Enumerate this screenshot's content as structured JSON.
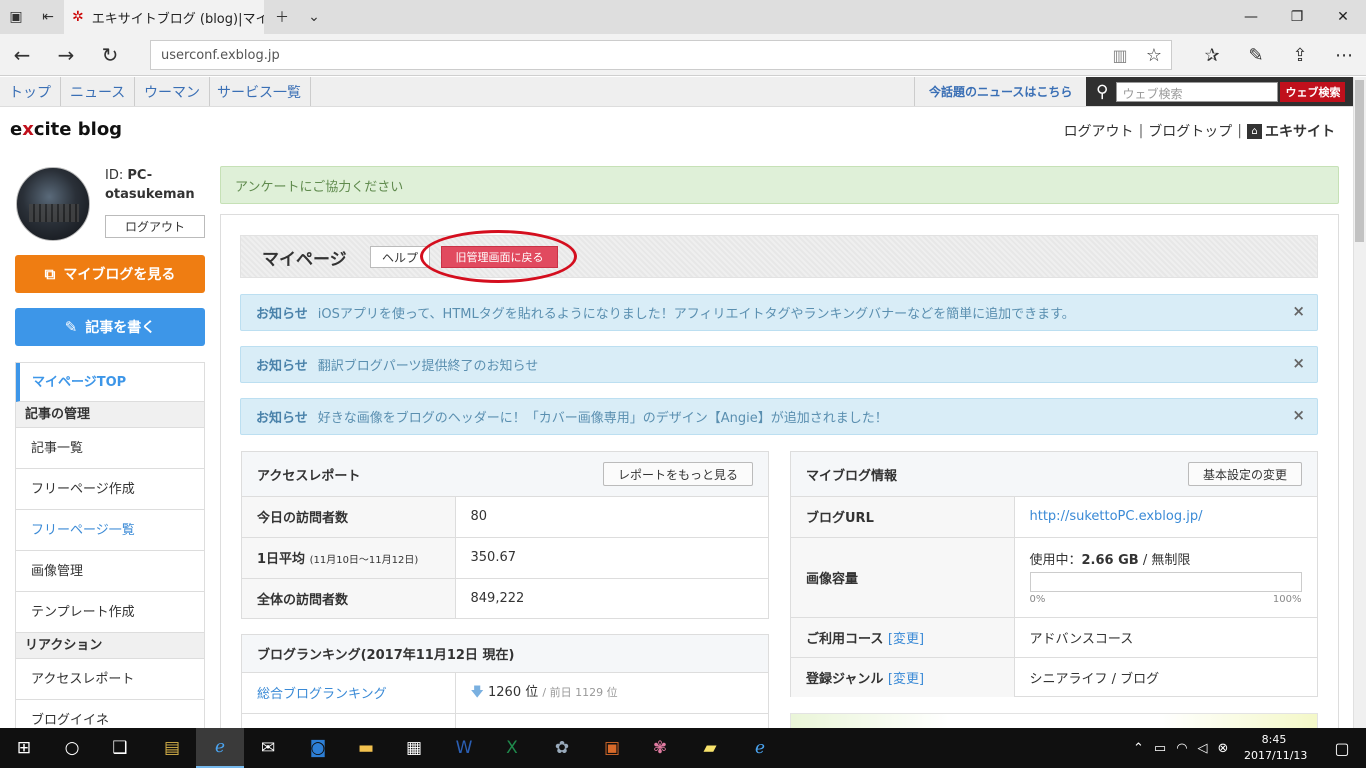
{
  "browser": {
    "tab_title": "エキサイトブログ (blog)|マイ",
    "address": "userconf.exblog.jp"
  },
  "site_nav": {
    "items": [
      "トップ",
      "ニュース",
      "ウーマン",
      "サービス一覧"
    ],
    "trending": "今話題のニュースはこちら",
    "search_placeholder": "ウェブ検索",
    "search_button": "ウェブ検索"
  },
  "header": {
    "logo_e": "e",
    "logo_x": "x",
    "logo_rest": "cite blog",
    "logout": "ログアウト",
    "blog_top": "ブログトップ",
    "excite": "エキサイト",
    "sep": "|"
  },
  "user": {
    "id_label": "ID:",
    "id_value": "PC-otasukeman",
    "logout": "ログアウト"
  },
  "side_buttons": {
    "myblog": "マイブログを見る",
    "write": "記事を書く"
  },
  "side_menu": {
    "top": "マイページTOP",
    "group1": "記事の管理",
    "items1": [
      "記事一覧",
      "フリーページ作成",
      "フリーページ一覧",
      "画像管理",
      "テンプレート作成"
    ],
    "group2": "リアクション",
    "items2": [
      "アクセスレポート",
      "ブログイイネ"
    ]
  },
  "survey": "アンケートにご協力ください",
  "mypage": {
    "title": "マイページ",
    "help": "ヘルプ",
    "old_admin": "旧管理画面に戻る"
  },
  "notices": [
    {
      "label": "お知らせ",
      "text": "iOSアプリを使って、HTMLタグを貼れるようになりました！アフィリエイトタグやランキングバナーなどを簡単に追加できます。"
    },
    {
      "label": "お知らせ",
      "text": "翻訳ブログパーツ提供終了のお知らせ"
    },
    {
      "label": "お知らせ",
      "text": "好きな画像をブログのヘッダーに！「カバー画像専用」のデザイン【Angie】が追加されました！"
    }
  ],
  "close_glyph": "×",
  "access": {
    "title": "アクセスレポート",
    "more": "レポートをもっと見る",
    "today_label": "今日の訪問者数",
    "today_value": "80",
    "avg_label": "1日平均",
    "avg_range": "(11月10日〜11月12日)",
    "avg_value": "350.67",
    "total_label": "全体の訪問者数",
    "total_value": "849,222"
  },
  "ranking": {
    "title": "ブログランキング(2017年11月12日 現在)",
    "overall_label": "総合ブログランキング",
    "overall_rank": "1260 位",
    "prev": "/ 前日 1129 位"
  },
  "blog_info": {
    "title": "マイブログ情報",
    "settings": "基本設定の変更",
    "url_label": "ブログURL",
    "url_value": "http://sukettoPC.exblog.jp/",
    "capacity_label": "画像容量",
    "usage_prefix": "使用中：",
    "usage_value": "2.66 GB",
    "usage_suffix": "/ 無制限",
    "usage_fraction": 0.0,
    "bar_min": "0%",
    "bar_max": "100%",
    "course_label": "ご利用コース",
    "course_change": "[変更]",
    "course_value": "アドバンスコース",
    "genre_label": "登録ジャンル",
    "genre_change": "[変更]",
    "genre_value": "シニアライフ / ブログ"
  },
  "taskbar": {
    "time": "8:45",
    "date": "2017/11/13"
  },
  "colors": {
    "orange": "#ef7d12",
    "blue": "#3d96e8",
    "red": "#e14a5f",
    "annotation": "#d40e1e"
  }
}
